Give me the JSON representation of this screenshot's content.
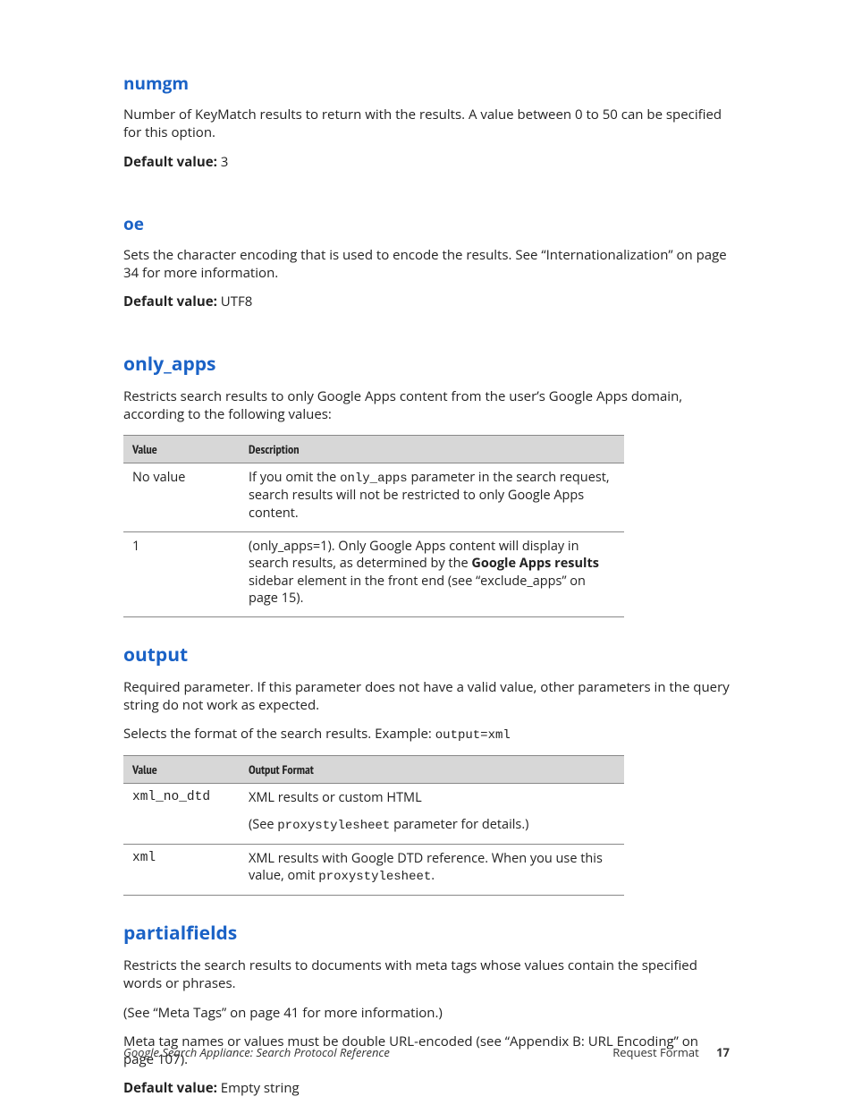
{
  "numgm": {
    "heading": "numgm",
    "body": "Number of KeyMatch results to return with the results. A value between 0 to 50 can be specified for this option.",
    "default_label": "Default value:",
    "default_value": " 3"
  },
  "oe": {
    "heading": "oe",
    "body": "Sets the character encoding that is used to encode the results. See “Internationalization” on page 34 for more information.",
    "default_label": "Default value:",
    "default_value": " UTF8"
  },
  "only_apps": {
    "heading": "only_apps",
    "body": "Restricts search results to only Google Apps content from the user’s Google Apps domain, according to the following values:",
    "col1": "Value",
    "col2": "Description",
    "row1_value": "No value",
    "row1_desc_pre": "If you omit the ",
    "row1_desc_code": "only_apps",
    "row1_desc_post": " parameter in the search request, search results will not be restricted to only Google Apps content.",
    "row2_value": "1",
    "row2_desc_pre": "(only_apps=1). Only Google Apps content will display in search results, as determined by the ",
    "row2_desc_bold": "Google Apps results",
    "row2_desc_post": " sidebar element in the front end (see “exclude_apps” on page 15)."
  },
  "output": {
    "heading": "output",
    "body1": "Required parameter. If this parameter does not have a valid value, other parameters in the query string do not work as expected.",
    "body2_pre": "Selects the format of the search results. Example: ",
    "body2_code": "output=xml",
    "col1": "Value",
    "col2": "Output Format",
    "row1_value": "xml_no_dtd",
    "row1_desc_line1": "XML results or custom HTML",
    "row1_desc_line2_pre": "(See ",
    "row1_desc_line2_code": "proxystylesheet",
    "row1_desc_line2_post": " parameter for details.)",
    "row2_value": "xml",
    "row2_desc_pre": "XML results with Google DTD reference. When you use this value, omit ",
    "row2_desc_code": "proxystylesheet",
    "row2_desc_post": "."
  },
  "partialfields": {
    "heading": "partialfields",
    "body1": "Restricts the search results to documents with meta tags whose values contain the specified words or phrases.",
    "body2": "(See “Meta Tags” on page 41 for more information.)",
    "body3": "Meta tag names or values must be double URL-encoded (see “Appendix B: URL Encoding” on page 107).",
    "default_label": "Default value:",
    "default_value": " Empty string"
  },
  "footer": {
    "doc_title": "Google Search Appliance: Search Protocol Reference",
    "section": "Request Format",
    "page": "17"
  }
}
